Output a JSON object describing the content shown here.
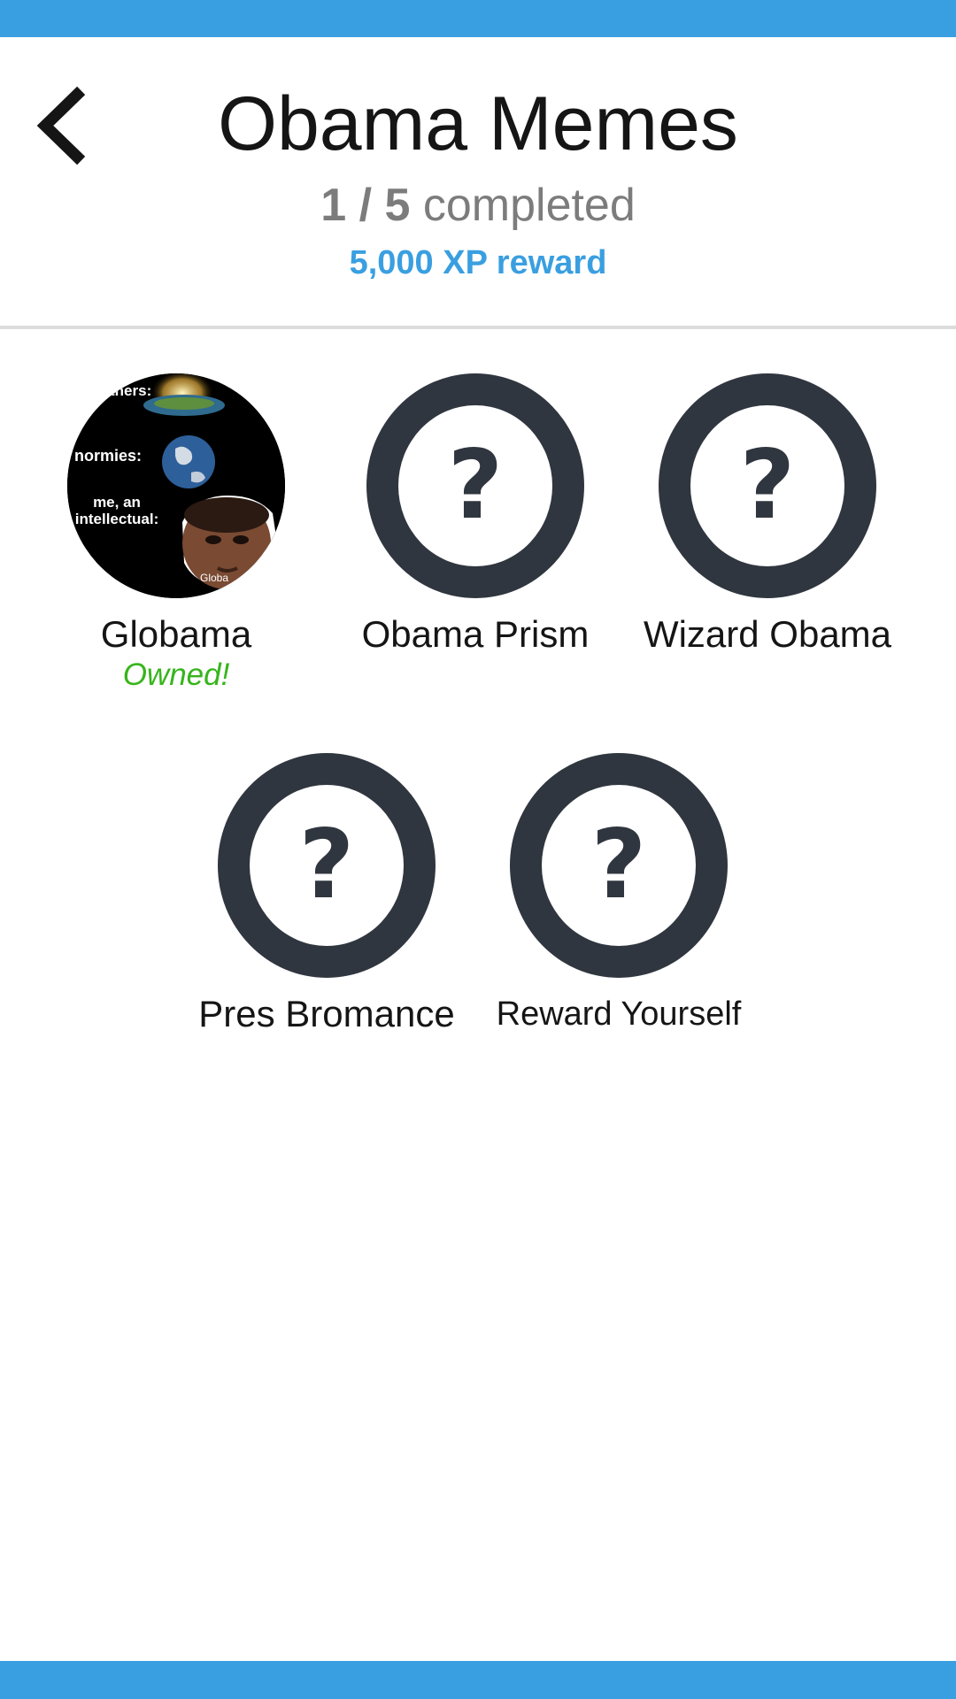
{
  "header": {
    "title": "Obama Memes",
    "completed_count": "1",
    "separator": "/",
    "total_count": "5",
    "completed_label": "completed",
    "reward": "5,000 XP reward"
  },
  "items": [
    {
      "label": "Globama",
      "status": "Owned!",
      "owned": true,
      "art_texts": [
        "thers:",
        "normies:",
        "me, an intellectual:",
        "Globa"
      ]
    },
    {
      "label": "Obama Prism",
      "placeholder": "?",
      "owned": false
    },
    {
      "label": "Wizard Obama",
      "placeholder": "?",
      "owned": false
    },
    {
      "label": "Pres Bromance",
      "placeholder": "?",
      "owned": false
    },
    {
      "label": "Reward Yourself",
      "placeholder": "?",
      "owned": false
    }
  ],
  "colors": {
    "accent": "#3a9fe0",
    "locked_ring": "#30363f",
    "owned_status": "#36b51b"
  },
  "icons": {
    "back": "chevron-left-icon"
  }
}
